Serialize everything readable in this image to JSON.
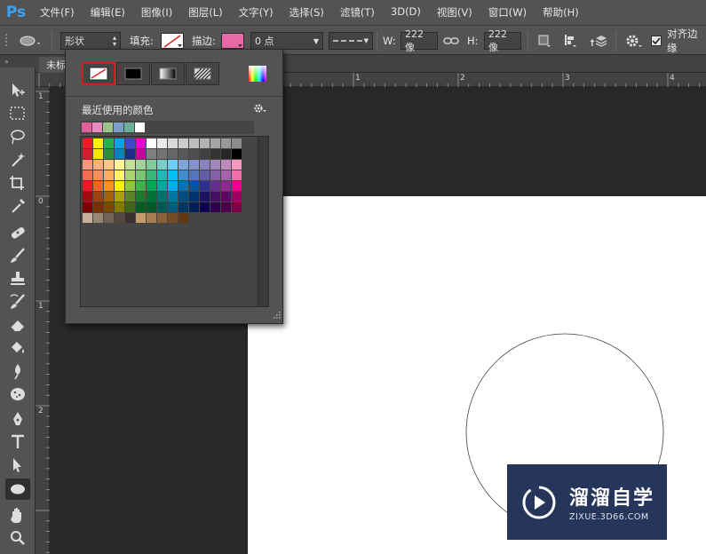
{
  "app": {
    "logo": "Ps"
  },
  "menu": [
    "文件(F)",
    "编辑(E)",
    "图像(I)",
    "图层(L)",
    "文字(Y)",
    "选择(S)",
    "滤镜(T)",
    "3D(D)",
    "视图(V)",
    "窗口(W)",
    "帮助(H)"
  ],
  "options": {
    "mode_value": "形状",
    "fill_label": "填充:",
    "stroke_label": "描边:",
    "stroke_width": "0 点",
    "w_label": "W:",
    "w_value": "222 像",
    "h_label": "H:",
    "h_value": "222 像",
    "align_edges": "对齐边缘"
  },
  "tab": {
    "title": "未标"
  },
  "ruler_top": [
    "1",
    "2",
    "3",
    "4"
  ],
  "ruler_left": [
    "1",
    "0",
    "1",
    "2"
  ],
  "panel": {
    "recent_label": "最近使用的颜色",
    "recent_colors": [
      "#e0609a",
      "#e88ac0",
      "#9cc48a",
      "#7aa0c8",
      "#6ab09a",
      "#ffffff"
    ],
    "swatch_rows": [
      [
        "#ee1c24",
        "#fff200",
        "#22b14c",
        "#00a2e8",
        "#3f48cc",
        "#ec00d8",
        "#ffffff",
        "#eaeaea",
        "#d9d9d9",
        "#cccccc",
        "#bfbfbf",
        "#b2b2b2",
        "#a6a6a6",
        "#999999",
        "#8c8c8c"
      ],
      [
        "#d01f2a",
        "#f7e600",
        "#2e8e3c",
        "#0a7fc2",
        "#1f2b88",
        "#c8009e",
        "#7f7f7f",
        "#737373",
        "#666666",
        "#595959",
        "#4d4d4d",
        "#404040",
        "#333333",
        "#262626",
        "#000000"
      ],
      [
        "#f5977a",
        "#f9ad81",
        "#fdc68a",
        "#fff79a",
        "#c4df9b",
        "#a3d39c",
        "#82ca9c",
        "#7bcdc8",
        "#6dcff6",
        "#7da7d9",
        "#8493ca",
        "#8781bd",
        "#a187be",
        "#bc8cbf",
        "#f49ac1"
      ],
      [
        "#f26c4f",
        "#f68e55",
        "#fbaf5c",
        "#fff467",
        "#acd372",
        "#7cc576",
        "#3bb878",
        "#1abbb4",
        "#00bff3",
        "#438ccb",
        "#5574b9",
        "#605ca8",
        "#855fa8",
        "#a763a9",
        "#f06ea9"
      ],
      [
        "#ed1c24",
        "#f26522",
        "#f7941d",
        "#fff200",
        "#8dc63f",
        "#39b54a",
        "#00a651",
        "#00a99d",
        "#00aeef",
        "#0072bc",
        "#0054a5",
        "#2e3192",
        "#662d91",
        "#92278f",
        "#ec008c"
      ],
      [
        "#9e0b0f",
        "#a0410d",
        "#a3620a",
        "#aba000",
        "#598527",
        "#1a7b30",
        "#007236",
        "#00746b",
        "#0076a3",
        "#004b80",
        "#003471",
        "#1b1464",
        "#440e62",
        "#630460",
        "#9e005d"
      ],
      [
        "#790000",
        "#7b2e00",
        "#7d4900",
        "#827b00",
        "#406618",
        "#005e20",
        "#005826",
        "#005952",
        "#005b7f",
        "#003663",
        "#002157",
        "#0d004c",
        "#32004b",
        "#4b0049",
        "#7b0046"
      ],
      [
        "#c7b299",
        "#998675",
        "#736357",
        "#534741",
        "#37302d",
        "#c69c6d",
        "#a67c52",
        "#8c6239",
        "#754c24",
        "#603913"
      ]
    ]
  },
  "watermark": {
    "brand": "溜溜自学",
    "url": "ZIXUE.3D66.COM"
  }
}
